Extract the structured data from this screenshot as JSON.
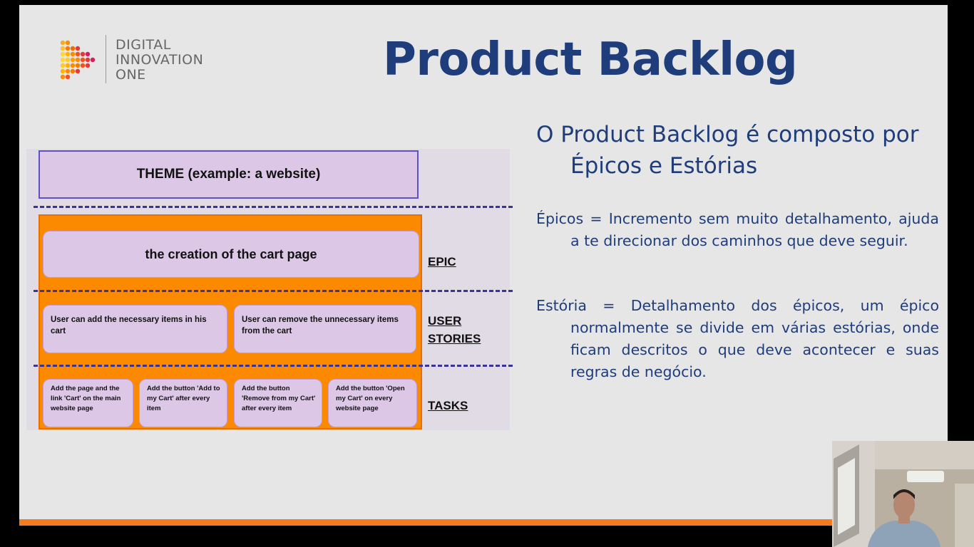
{
  "logo": {
    "line1": "DIGITAL",
    "line2": "INNOVATION",
    "line3": "ONE",
    "colors": [
      "#f9a825",
      "#f47b20",
      "#e53935",
      "#d81b60"
    ]
  },
  "title": "Product Backlog",
  "diagram": {
    "theme": "THEME (example: a website)",
    "epic": "the creation of the cart page",
    "stories": [
      "User can add the necessary items in his cart",
      "User can remove the unnecessary items from the cart"
    ],
    "tasks": [
      "Add the page and the link 'Cart' on the main website page",
      "Add the button 'Add to my Cart' after every item",
      "Add the button 'Remove from my Cart' after every item",
      "Add the button 'Open my Cart' on every website page"
    ],
    "labels": {
      "epic": "EPIC",
      "stories_line1": "USER",
      "stories_line2": "STORIES",
      "tasks": "TASKS"
    }
  },
  "subtitle": "O Product Backlog é composto por Épicos e Estórias",
  "paragraphs": {
    "epicos": "Épicos = Incremento sem muito detalhamento, ajuda a te direcionar dos caminhos que deve seguir.",
    "estoria": "Estória = Detalhamento dos épicos, um épico normalmente se divide em várias estórias, onde ficam descritos o que deve acontecer e suas regras de negócio."
  },
  "colors": {
    "title_blue": "#1f3d7a",
    "accent_orange": "#f47b20",
    "box_lilac": "#dcc8e6",
    "dash_purple": "#3a3496"
  }
}
